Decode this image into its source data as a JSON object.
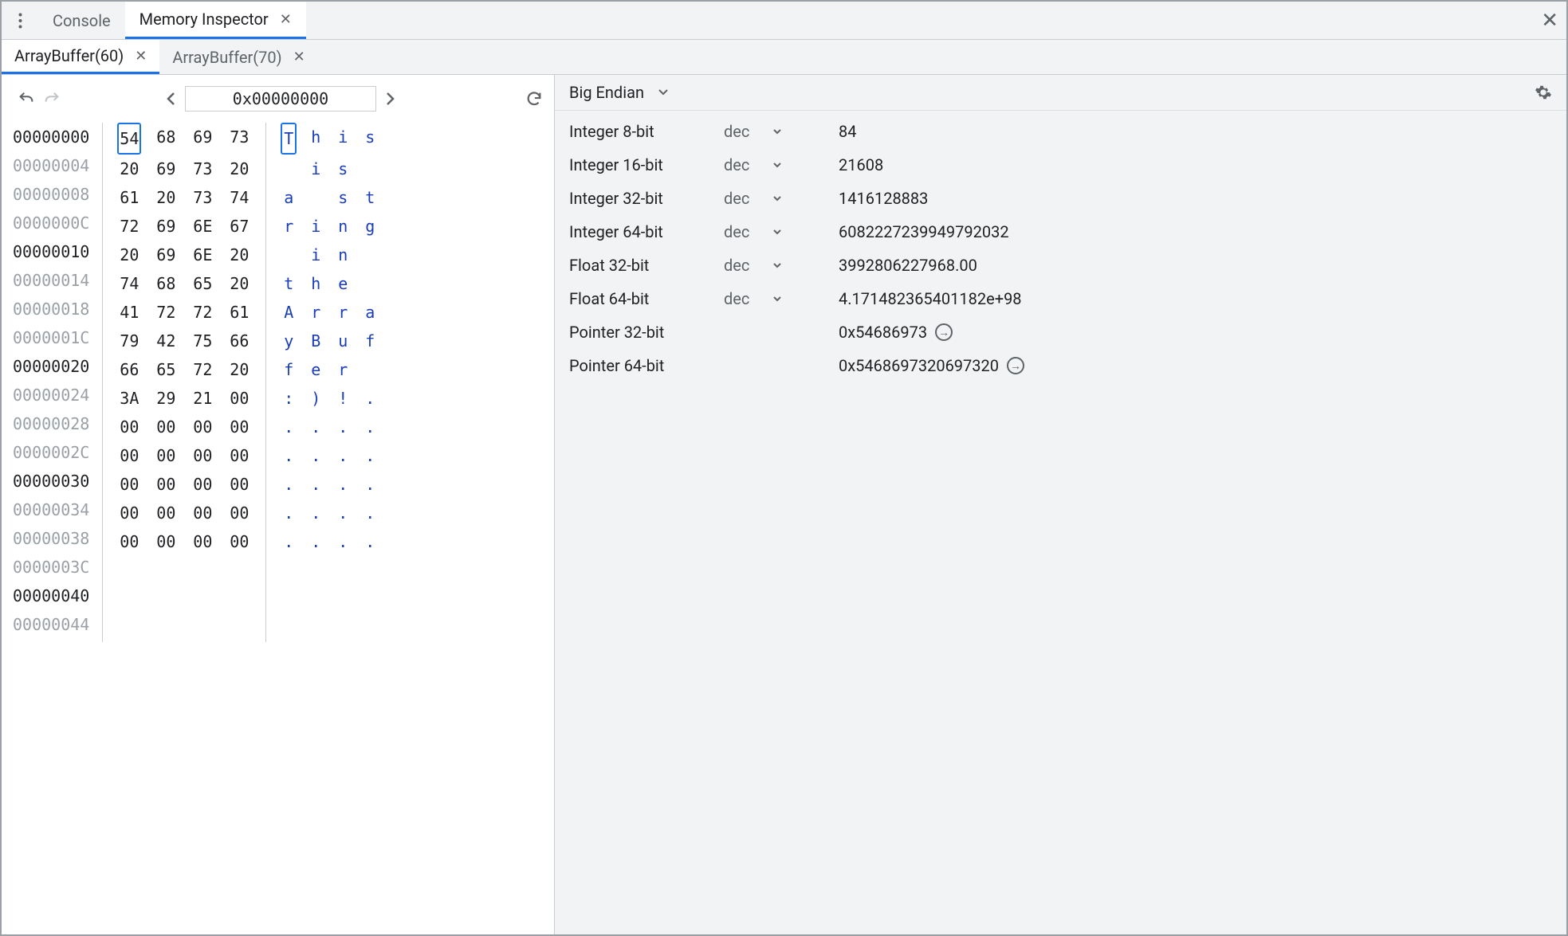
{
  "top_tabs": [
    {
      "label": "Console",
      "closeable": false,
      "active": false
    },
    {
      "label": "Memory Inspector",
      "closeable": true,
      "active": true
    }
  ],
  "buffer_tabs": [
    {
      "label": "ArrayBuffer(60)",
      "active": true
    },
    {
      "label": "ArrayBuffer(70)",
      "active": false
    }
  ],
  "nav": {
    "address": "0x00000000"
  },
  "hex_rows": [
    {
      "addr": "00000000",
      "strong": true,
      "bytes": [
        "54",
        "68",
        "69",
        "73"
      ],
      "ascii": [
        "T",
        "h",
        "i",
        "s"
      ],
      "sel": 0
    },
    {
      "addr": "00000004",
      "strong": false,
      "bytes": [
        "20",
        "69",
        "73",
        "20"
      ],
      "ascii": [
        "",
        "i",
        "s",
        ""
      ]
    },
    {
      "addr": "00000008",
      "strong": false,
      "bytes": [
        "61",
        "20",
        "73",
        "74"
      ],
      "ascii": [
        "a",
        "",
        "s",
        "t"
      ]
    },
    {
      "addr": "0000000C",
      "strong": false,
      "bytes": [
        "72",
        "69",
        "6E",
        "67"
      ],
      "ascii": [
        "r",
        "i",
        "n",
        "g"
      ]
    },
    {
      "addr": "00000010",
      "strong": true,
      "bytes": [
        "20",
        "69",
        "6E",
        "20"
      ],
      "ascii": [
        "",
        "i",
        "n",
        ""
      ]
    },
    {
      "addr": "00000014",
      "strong": false,
      "bytes": [
        "74",
        "68",
        "65",
        "20"
      ],
      "ascii": [
        "t",
        "h",
        "e",
        ""
      ]
    },
    {
      "addr": "00000018",
      "strong": false,
      "bytes": [
        "41",
        "72",
        "72",
        "61"
      ],
      "ascii": [
        "A",
        "r",
        "r",
        "a"
      ]
    },
    {
      "addr": "0000001C",
      "strong": false,
      "bytes": [
        "79",
        "42",
        "75",
        "66"
      ],
      "ascii": [
        "y",
        "B",
        "u",
        "f"
      ]
    },
    {
      "addr": "00000020",
      "strong": true,
      "bytes": [
        "66",
        "65",
        "72",
        "20"
      ],
      "ascii": [
        "f",
        "e",
        "r",
        ""
      ]
    },
    {
      "addr": "00000024",
      "strong": false,
      "bytes": [
        "3A",
        "29",
        "21",
        "00"
      ],
      "ascii": [
        ":",
        ")",
        "!",
        "."
      ]
    },
    {
      "addr": "00000028",
      "strong": false,
      "bytes": [
        "00",
        "00",
        "00",
        "00"
      ],
      "ascii": [
        ".",
        ".",
        ".",
        "."
      ]
    },
    {
      "addr": "0000002C",
      "strong": false,
      "bytes": [
        "00",
        "00",
        "00",
        "00"
      ],
      "ascii": [
        ".",
        ".",
        ".",
        "."
      ]
    },
    {
      "addr": "00000030",
      "strong": true,
      "bytes": [
        "00",
        "00",
        "00",
        "00"
      ],
      "ascii": [
        ".",
        ".",
        ".",
        "."
      ]
    },
    {
      "addr": "00000034",
      "strong": false,
      "bytes": [
        "00",
        "00",
        "00",
        "00"
      ],
      "ascii": [
        ".",
        ".",
        ".",
        "."
      ]
    },
    {
      "addr": "00000038",
      "strong": false,
      "bytes": [
        "00",
        "00",
        "00",
        "00"
      ],
      "ascii": [
        ".",
        ".",
        ".",
        "."
      ]
    },
    {
      "addr": "0000003C",
      "strong": false,
      "bytes": [],
      "ascii": []
    },
    {
      "addr": "00000040",
      "strong": true,
      "bytes": [],
      "ascii": []
    },
    {
      "addr": "00000044",
      "strong": false,
      "bytes": [],
      "ascii": []
    }
  ],
  "endianness": "Big Endian",
  "representations": [
    {
      "label": "Integer 8-bit",
      "format": "dec",
      "value": "84"
    },
    {
      "label": "Integer 16-bit",
      "format": "dec",
      "value": "21608"
    },
    {
      "label": "Integer 32-bit",
      "format": "dec",
      "value": "1416128883"
    },
    {
      "label": "Integer 64-bit",
      "format": "dec",
      "value": "6082227239949792032"
    },
    {
      "label": "Float 32-bit",
      "format": "dec",
      "value": "3992806227968.00"
    },
    {
      "label": "Float 64-bit",
      "format": "dec",
      "value": "4.171482365401182e+98"
    },
    {
      "label": "Pointer 32-bit",
      "format": "",
      "value": "0x54686973",
      "goto": true
    },
    {
      "label": "Pointer 64-bit",
      "format": "",
      "value": "0x5468697320697320",
      "goto": true
    }
  ]
}
